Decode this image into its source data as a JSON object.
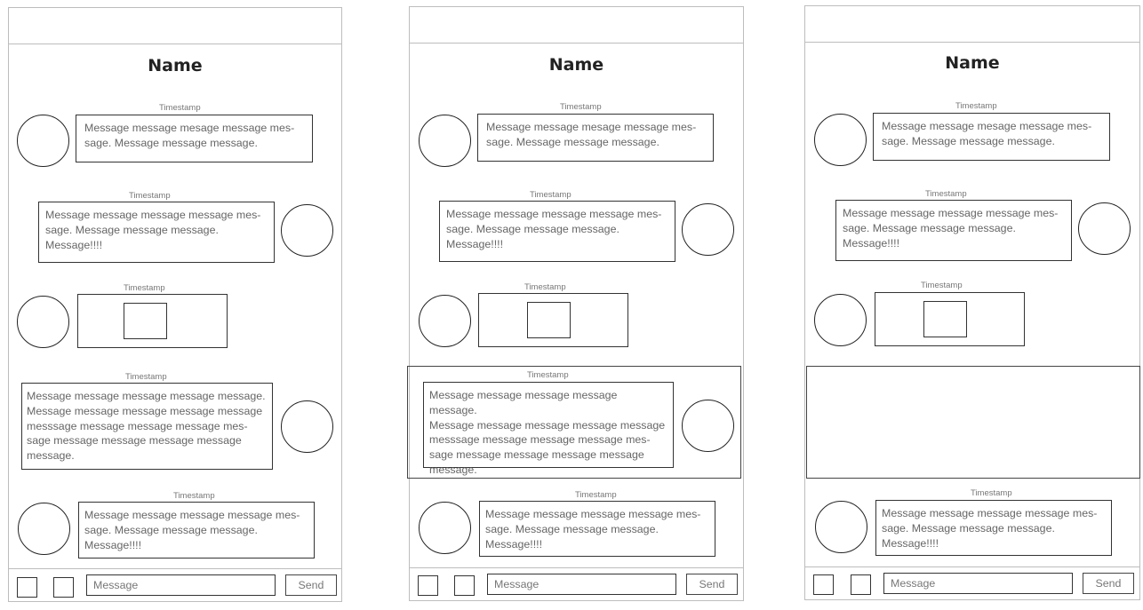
{
  "screens": [
    {
      "title": "Name",
      "messages": [
        {
          "timestamp": "Timestamp",
          "text": "Message message mesage message mes-\nsage. Message message message."
        },
        {
          "timestamp": "Timestamp",
          "text": "Message message message message mes-\nsage. Message message message.\nMessage!!!!"
        },
        {
          "timestamp": "Timestamp",
          "text": ""
        },
        {
          "timestamp": "Timestamp",
          "text": "Message message message message message.\nMessage message message message message\nmesssage message message message mes-\nsage message message message message\nmessage."
        },
        {
          "timestamp": "Timestamp",
          "text": "Message message message message mes-\nsage. Message message message.\nMessage!!!!"
        }
      ],
      "input_placeholder": "Message",
      "send_label": "Send"
    },
    {
      "title": "Name",
      "messages": [
        {
          "timestamp": "Timestamp",
          "text": "Message message mesage message mes-\nsage. Message message message."
        },
        {
          "timestamp": "Timestamp",
          "text": "Message message message message mes-\nsage. Message message message.\nMessage!!!!"
        },
        {
          "timestamp": "Timestamp",
          "text": ""
        },
        {
          "timestamp": "Timestamp",
          "text": "Message message message message message.\nMessage message message message message\nmesssage message message message mes-\nsage message message message message\nmessage."
        },
        {
          "timestamp": "Timestamp",
          "text": "Message message message message mes-\nsage. Message message message.\nMessage!!!!"
        }
      ],
      "input_placeholder": "Message",
      "send_label": "Send"
    },
    {
      "title": "Name",
      "messages": [
        {
          "timestamp": "Timestamp",
          "text": "Message message mesage message mes-\nsage. Message message message."
        },
        {
          "timestamp": "Timestamp",
          "text": "Message message message message mes-\nsage. Message message message.\nMessage!!!!"
        },
        {
          "timestamp": "Timestamp",
          "text": ""
        },
        {
          "timestamp": "Timestamp",
          "text": "Message message message message mes-\nsage. Message message message.\nMessage!!!!"
        }
      ],
      "input_placeholder": "Message",
      "send_label": "Send"
    }
  ]
}
